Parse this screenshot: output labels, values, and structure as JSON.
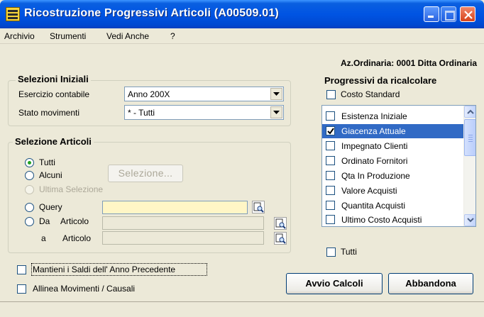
{
  "window": {
    "title": "Ricostruzione Progressivi Articoli (A00509.01)"
  },
  "menu": [
    {
      "label": "Archivio"
    },
    {
      "label": "Strumenti"
    },
    {
      "label": "Vedi Anche"
    },
    {
      "label": "?"
    }
  ],
  "company": "Az.Ordinaria: 0001 Ditta Ordinaria",
  "selezioni": {
    "title": "Selezioni Iniziali",
    "esercizio_label": "Esercizio contabile",
    "esercizio_value": "Anno 200X",
    "stato_label": "Stato movimenti",
    "stato_value": "* - Tutti"
  },
  "articoli": {
    "title": "Selezione Articoli",
    "radio_tutti": "Tutti",
    "radio_alcuni": "Alcuni",
    "selezione_button": "Selezione...",
    "radio_ultima": "Ultima Selezione",
    "radio_query": "Query",
    "radio_da": "Da",
    "da_articolo_label": "Articolo",
    "a_label": "a",
    "a_articolo_label": "Articolo",
    "selected": "Tutti"
  },
  "options": {
    "mantieni_saldi": "Mantieni i Saldi dell' Anno Precedente",
    "mantieni_checked": false,
    "allinea": "Allinea Movimenti / Causali",
    "allinea_checked": false
  },
  "progressivi": {
    "title": "Progressivi da ricalcolare",
    "costo_standard": "Costo Standard",
    "costo_standard_checked": false,
    "items": [
      {
        "label": "Esistenza Iniziale",
        "checked": false,
        "selected": false
      },
      {
        "label": "Giacenza Attuale",
        "checked": true,
        "selected": true
      },
      {
        "label": "Impegnato Clienti",
        "checked": false,
        "selected": false
      },
      {
        "label": "Ordinato Fornitori",
        "checked": false,
        "selected": false
      },
      {
        "label": "Qta In Produzione",
        "checked": false,
        "selected": false
      },
      {
        "label": "Valore Acquisti",
        "checked": false,
        "selected": false
      },
      {
        "label": "Quantita Acquisti",
        "checked": false,
        "selected": false
      },
      {
        "label": "Ultimo Costo Acquisti",
        "checked": false,
        "selected": false
      }
    ],
    "tutti": "Tutti",
    "tutti_checked": false
  },
  "buttons": {
    "avvio": "Avvio Calcoli",
    "abbandona": "Abbandona"
  },
  "icons": {
    "app": "app-icon",
    "lookup": "lookup-icon",
    "dropdown": "chevron-down-icon"
  }
}
